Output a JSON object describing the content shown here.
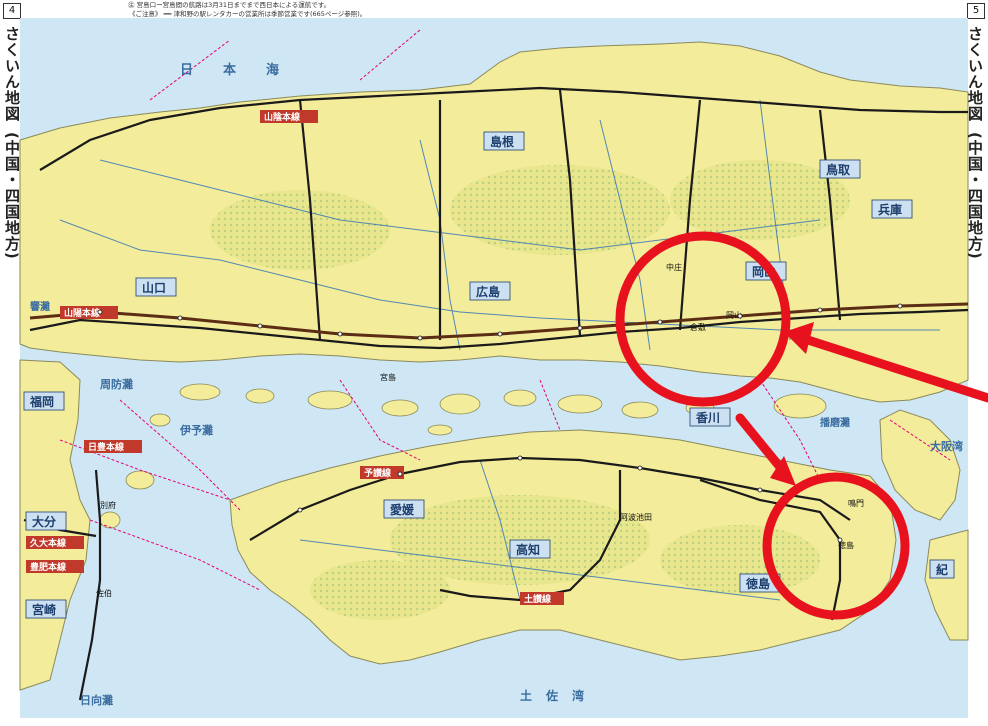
{
  "page_numbers": {
    "left": "4",
    "right": "5"
  },
  "side_title": "さくいん地図",
  "side_subtitle": "(中国・四国地方)",
  "notes": {
    "line1": "㊟ 宮島口ー宮島間の航路は3月31日までまで西日本による運航です。",
    "line2": "《ご注意》 ━━ 津和野の駅レンタカーの営業所は季節営業です(665ページ参照)。"
  },
  "seas": [
    {
      "name": "日本海"
    },
    {
      "name": "響灘"
    },
    {
      "name": "周防灘"
    },
    {
      "name": "伊予灘"
    },
    {
      "name": "土佐湾"
    },
    {
      "name": "日向灘"
    },
    {
      "name": "播磨灘"
    },
    {
      "name": "大阪湾"
    }
  ],
  "prefectures": [
    {
      "name": "山口"
    },
    {
      "name": "広島"
    },
    {
      "name": "岡山"
    },
    {
      "name": "島根"
    },
    {
      "name": "鳥取"
    },
    {
      "name": "兵庫"
    },
    {
      "name": "福岡"
    },
    {
      "name": "大分"
    },
    {
      "name": "宮崎"
    },
    {
      "name": "愛媛"
    },
    {
      "name": "高知"
    },
    {
      "name": "徳島"
    },
    {
      "name": "香川"
    },
    {
      "name": "紀"
    }
  ],
  "rail_lines": [
    {
      "name": "山陽本線"
    },
    {
      "name": "山陰本線"
    },
    {
      "name": "予讃線"
    },
    {
      "name": "土讃線"
    },
    {
      "name": "久大本線"
    },
    {
      "name": "豊肥本線"
    },
    {
      "name": "日豊本線"
    }
  ],
  "places": [
    {
      "name": "中庄"
    },
    {
      "name": "倉敷"
    },
    {
      "name": "岡山"
    },
    {
      "name": "徳島"
    },
    {
      "name": "鳴門"
    },
    {
      "name": "阿波池田"
    },
    {
      "name": "別府"
    },
    {
      "name": "宮島"
    },
    {
      "name": "佐伯"
    }
  ],
  "annotations": [
    {
      "name": "circle-okayama-area",
      "color": "#e8121e"
    },
    {
      "name": "circle-tokushima-area",
      "color": "#e8121e"
    },
    {
      "name": "arrow-okayama",
      "color": "#e8121e"
    },
    {
      "name": "arrow-connector",
      "color": "#e8121e"
    }
  ],
  "colors": {
    "land": "#f3ec9a",
    "sea": "#cfe7f4",
    "mountain": "#bfd68e",
    "rail": "#1a1a1a",
    "shinkansen": "#5a2d14",
    "ferry": "#e4007f",
    "road": "#2a6fb8",
    "annotation": "#e8121e"
  }
}
